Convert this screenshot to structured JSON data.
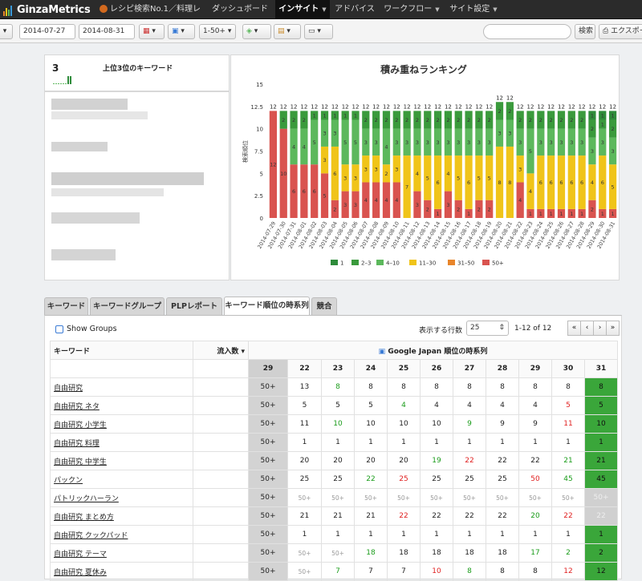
{
  "app": {
    "logo": "GinzaMetrics",
    "site": "レシピ検索No.1／料理レ...",
    "menu": [
      {
        "label": "ダッシュボード",
        "caret": false,
        "active": false
      },
      {
        "label": "インサイト",
        "caret": true,
        "active": true
      },
      {
        "label": "アドバイス",
        "caret": false,
        "active": false
      },
      {
        "label": "ワークフロー",
        "caret": true,
        "active": false
      },
      {
        "label": "サイト設定",
        "caret": true,
        "active": false
      }
    ]
  },
  "toolbar": {
    "date_from": "2014-07-27",
    "date_to": "2014-08-31",
    "rank_filter": "1-50+",
    "search_placeholder": "",
    "search_button": "検索",
    "export_button": "エクスポー"
  },
  "kpi": {
    "value": "3",
    "label": "上位3位のキーワード"
  },
  "chart_data": {
    "type": "bar",
    "stacked": true,
    "title": "積み重ねランキング",
    "ylabel": "検索順位",
    "ylim": [
      0,
      15
    ],
    "yticks": [
      "0",
      "2.5",
      "5",
      "7.5",
      "10",
      "12.5",
      "15"
    ],
    "grid": false,
    "legend_position": "bottom",
    "categories": [
      "2014-07-29",
      "2014-07-30",
      "2014-07-31",
      "2014-08-01",
      "2014-08-02",
      "2014-08-03",
      "2014-08-04",
      "2014-08-05",
      "2014-08-06",
      "2014-08-07",
      "2014-08-08",
      "2014-08-09",
      "2014-08-10",
      "2014-08-11",
      "2014-08-12",
      "2014-08-13",
      "2014-08-14",
      "2014-08-15",
      "2014-08-16",
      "2014-08-17",
      "2014-08-18",
      "2014-08-19",
      "2014-08-20",
      "2014-08-21",
      "2014-08-22",
      "2014-08-23",
      "2014-08-24",
      "2014-08-25",
      "2014-08-26",
      "2014-08-27",
      "2014-08-28",
      "2014-08-29",
      "2014-08-30",
      "2014-08-31"
    ],
    "totals": [
      12,
      12,
      12,
      12,
      12,
      12,
      12,
      12,
      12,
      12,
      12,
      12,
      12,
      12,
      12,
      12,
      12,
      12,
      12,
      12,
      12,
      12,
      12,
      12,
      12,
      12,
      12,
      12,
      12,
      12,
      12,
      12,
      12,
      12
    ],
    "series": [
      {
        "name": "1",
        "color": "#2e8b3a",
        "values": [
          0,
          0,
          0,
          0,
          0,
          0,
          0,
          0,
          0,
          0,
          0,
          0,
          0,
          0,
          0,
          0,
          0,
          0,
          0,
          0,
          0,
          0,
          0,
          0,
          0,
          0,
          0,
          0,
          0,
          0,
          0,
          1,
          1,
          1
        ]
      },
      {
        "name": "2–3",
        "color": "#3a9a3c",
        "values": [
          0,
          2,
          2,
          2,
          1,
          1,
          1,
          1,
          1,
          2,
          2,
          2,
          2,
          2,
          2,
          2,
          2,
          2,
          2,
          2,
          2,
          2,
          2,
          2,
          2,
          2,
          2,
          2,
          2,
          2,
          2,
          2,
          1,
          2
        ]
      },
      {
        "name": "4–10",
        "color": "#5cb85c",
        "values": [
          0,
          0,
          4,
          4,
          5,
          3,
          3,
          5,
          5,
          3,
          3,
          4,
          3,
          3,
          3,
          3,
          3,
          3,
          3,
          3,
          3,
          3,
          3,
          3,
          3,
          5,
          3,
          3,
          3,
          3,
          3,
          3,
          3,
          3
        ]
      },
      {
        "name": "11–30",
        "color": "#f0c419",
        "values": [
          0,
          0,
          0,
          0,
          0,
          3,
          6,
          3,
          3,
          3,
          3,
          2,
          3,
          7,
          4,
          5,
          6,
          4,
          5,
          6,
          5,
          5,
          8,
          8,
          3,
          4,
          6,
          6,
          6,
          6,
          6,
          4,
          6,
          5
        ]
      },
      {
        "name": "31–50",
        "color": "#e8852b",
        "values": [
          0,
          0,
          0,
          0,
          0,
          0,
          0,
          0,
          0,
          0,
          0,
          0,
          0,
          0,
          0,
          0,
          0,
          0,
          0,
          0,
          0,
          0,
          0,
          0,
          0,
          0,
          0,
          0,
          0,
          0,
          0,
          0,
          0,
          0
        ]
      },
      {
        "name": "50+",
        "color": "#d9534f",
        "values": [
          12,
          10,
          6,
          6,
          6,
          5,
          2,
          3,
          3,
          4,
          4,
          4,
          4,
          0,
          3,
          2,
          1,
          3,
          2,
          1,
          2,
          2,
          0,
          0,
          4,
          1,
          1,
          1,
          1,
          1,
          1,
          2,
          1,
          1
        ]
      }
    ]
  },
  "tabs": [
    {
      "label": "キーワード",
      "active": false
    },
    {
      "label": "キーワードグループ",
      "active": false
    },
    {
      "label": "PLPレポート",
      "active": false
    },
    {
      "label": "キーワード順位の時系列",
      "active": true
    },
    {
      "label": "競合",
      "active": false
    }
  ],
  "controls": {
    "show_groups": "Show Groups",
    "rows_label": "表示する行数",
    "rows_value": "25",
    "range": "1-12 of 12",
    "pager": [
      "«",
      "‹",
      "›",
      "»"
    ]
  },
  "table": {
    "col_keyword": "キーワード",
    "col_traffic": "流入数 ▾",
    "group_header": "Google Japan 順位の時系列",
    "days": [
      "29",
      "22",
      "23",
      "24",
      "25",
      "26",
      "27",
      "28",
      "29",
      "30",
      "31"
    ],
    "rows": [
      {
        "kw": "自由研究",
        "c": [
          "50+",
          "13",
          "8",
          "8",
          "8",
          "8",
          "8",
          "8",
          "8",
          "8",
          "8"
        ],
        "t": [
          "",
          "",
          "g",
          "",
          "",
          "",
          "",
          "",
          "",
          "",
          "g"
        ]
      },
      {
        "kw": "自由研究 ネタ",
        "c": [
          "50+",
          "5",
          "5",
          "5",
          "4",
          "4",
          "4",
          "4",
          "4",
          "5",
          "5"
        ],
        "t": [
          "",
          "",
          "",
          "",
          "g",
          "",
          "",
          "",
          "",
          "r",
          "g"
        ]
      },
      {
        "kw": "自由研究 小学生",
        "c": [
          "50+",
          "11",
          "10",
          "10",
          "10",
          "10",
          "9",
          "9",
          "9",
          "11",
          "10"
        ],
        "t": [
          "",
          "",
          "g",
          "",
          "",
          "",
          "g",
          "",
          "",
          "r",
          "g"
        ]
      },
      {
        "kw": "自由研究 料理",
        "c": [
          "50+",
          "1",
          "1",
          "1",
          "1",
          "1",
          "1",
          "1",
          "1",
          "1",
          "1"
        ],
        "t": [
          "",
          "",
          "",
          "",
          "",
          "",
          "",
          "",
          "",
          "",
          "g"
        ]
      },
      {
        "kw": "自由研究 中学生",
        "c": [
          "50+",
          "20",
          "20",
          "20",
          "20",
          "19",
          "22",
          "22",
          "22",
          "21",
          "21"
        ],
        "t": [
          "",
          "",
          "",
          "",
          "",
          "g",
          "r",
          "",
          "",
          "g",
          "g"
        ]
      },
      {
        "kw": "パックン",
        "c": [
          "50+",
          "25",
          "25",
          "22",
          "25",
          "25",
          "25",
          "25",
          "50",
          "45",
          "45"
        ],
        "t": [
          "",
          "",
          "",
          "g",
          "r",
          "",
          "",
          "",
          "r",
          "g",
          "g"
        ]
      },
      {
        "kw": "パトリックハーラン",
        "c": [
          "50+",
          "50+",
          "50+",
          "50+",
          "50+",
          "50+",
          "50+",
          "50+",
          "50+",
          "50+",
          "50+"
        ],
        "t": [
          "",
          "gr",
          "gr",
          "gr",
          "gr",
          "gr",
          "gr",
          "gr",
          "gr",
          "gr",
          "x"
        ]
      },
      {
        "kw": "自由研究 まとめ方",
        "c": [
          "50+",
          "21",
          "21",
          "21",
          "22",
          "22",
          "22",
          "22",
          "20",
          "22",
          "22"
        ],
        "t": [
          "",
          "",
          "",
          "",
          "r",
          "",
          "",
          "",
          "g",
          "r",
          "x"
        ]
      },
      {
        "kw": "自由研究 クックパッド",
        "c": [
          "50+",
          "1",
          "1",
          "1",
          "1",
          "1",
          "1",
          "1",
          "1",
          "1",
          "1"
        ],
        "t": [
          "",
          "",
          "",
          "",
          "",
          "",
          "",
          "",
          "",
          "",
          "g"
        ]
      },
      {
        "kw": "自由研究 テーマ",
        "c": [
          "50+",
          "50+",
          "50+",
          "18",
          "18",
          "18",
          "18",
          "18",
          "17",
          "2",
          "2"
        ],
        "t": [
          "",
          "gr",
          "gr",
          "g",
          "",
          "",
          "",
          "",
          "g",
          "g",
          "g"
        ]
      },
      {
        "kw": "自由研究 夏休み",
        "c": [
          "50+",
          "50+",
          "7",
          "7",
          "7",
          "10",
          "8",
          "8",
          "8",
          "12",
          "12"
        ],
        "t": [
          "",
          "gr",
          "g",
          "",
          "",
          "r",
          "g",
          "",
          "",
          "r",
          "g"
        ]
      }
    ]
  }
}
